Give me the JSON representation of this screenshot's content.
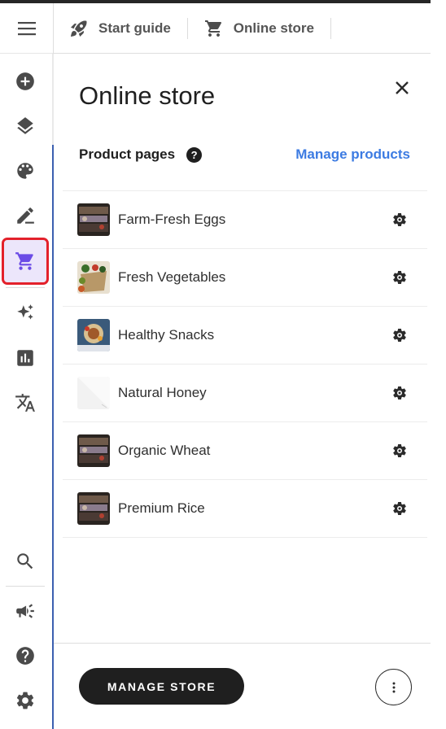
{
  "topbar": {
    "tabs": [
      {
        "label": "Start guide",
        "icon": "rocket-icon"
      },
      {
        "label": "Online store",
        "icon": "cart-icon"
      }
    ]
  },
  "rail": {
    "items": [
      {
        "icon": "add-circle-icon"
      },
      {
        "icon": "layers-icon"
      },
      {
        "icon": "palette-icon"
      },
      {
        "icon": "edit-icon"
      },
      {
        "icon": "cart-icon",
        "active": true
      },
      {
        "icon": "sparkle-icon"
      },
      {
        "icon": "analytics-icon"
      },
      {
        "icon": "translate-icon"
      },
      {
        "icon": "search-icon"
      },
      {
        "icon": "megaphone-icon"
      },
      {
        "icon": "help-icon"
      },
      {
        "icon": "settings-icon"
      }
    ]
  },
  "panel": {
    "title": "Online store",
    "section_label": "Product pages",
    "help_glyph": "?",
    "manage_link": "Manage products",
    "products": [
      {
        "name": "Farm-Fresh Eggs"
      },
      {
        "name": "Fresh Vegetables"
      },
      {
        "name": "Healthy Snacks"
      },
      {
        "name": "Natural Honey"
      },
      {
        "name": "Organic Wheat"
      },
      {
        "name": "Premium Rice"
      }
    ],
    "manage_store_label": "MANAGE STORE"
  },
  "colors": {
    "accent": "#6b4ce6",
    "active_bg": "#ece6fb",
    "highlight": "#e3212b",
    "link": "#3c7be2",
    "rail_accent": "#3b5fb0"
  }
}
